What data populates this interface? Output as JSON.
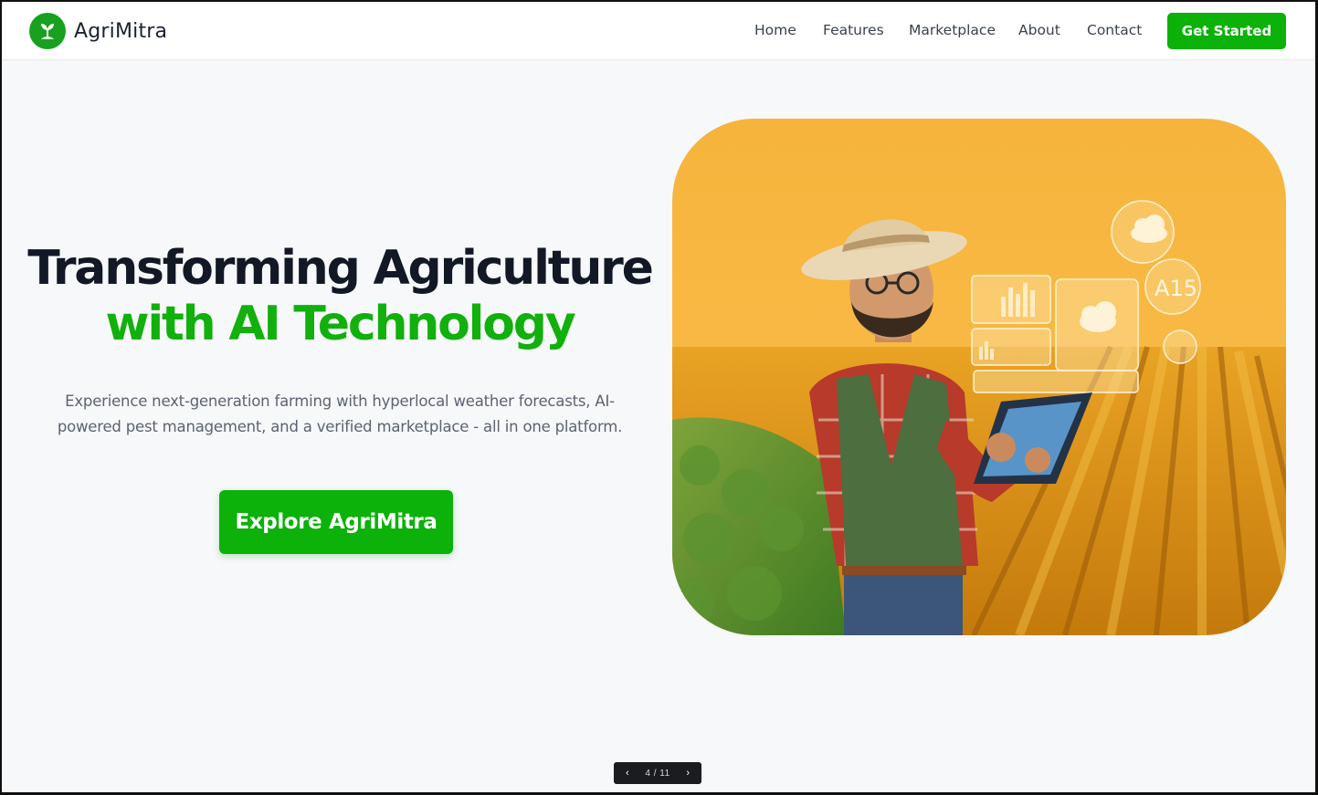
{
  "brand": {
    "name": "AgriMitra",
    "logo_icon": "sprout-icon",
    "color": "#18a01f"
  },
  "nav": {
    "links": [
      {
        "label": "Home"
      },
      {
        "label": "Features"
      },
      {
        "label": "Marketplace"
      },
      {
        "label": "About"
      },
      {
        "label": "Contact"
      }
    ],
    "cta_label": "Get Started"
  },
  "hero": {
    "title_line1": "Transforming Agriculture",
    "title_line2": "with AI Technology",
    "description": "Experience next-generation farming with hyperlocal weather forecasts, AI-powered pest management, and a verified marketplace - all in one platform.",
    "button_label": "Explore AgriMitra",
    "image_overlay_text": "A15"
  },
  "pager": {
    "prev_icon": "chevron-left-icon",
    "next_icon": "chevron-right-icon",
    "counter": "4 / 11"
  },
  "colors": {
    "accent": "#0cb10a",
    "heading": "#121826",
    "body_text": "#5c6370",
    "background": "#f7f8fa"
  }
}
